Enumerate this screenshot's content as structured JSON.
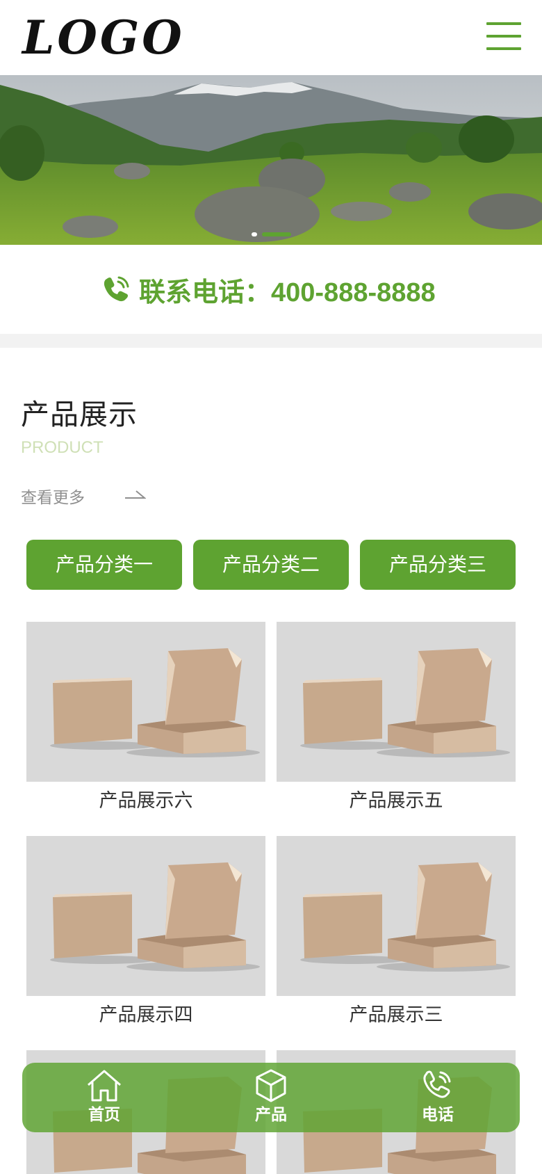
{
  "header": {
    "logo_text": "LOGO",
    "menu_icon": "hamburger-menu-icon"
  },
  "banner": {
    "alt_scene": "mountain-meadow-photo",
    "slide_count": 2,
    "active_slide": 2
  },
  "contact": {
    "phone_label": "联系电话：400-888-8888",
    "icon": "phone-icon"
  },
  "section": {
    "title": "产品展示",
    "subtitle": "PRODUCT",
    "more_label": "查看更多"
  },
  "categories": [
    {
      "label": "产品分类一"
    },
    {
      "label": "产品分类二"
    },
    {
      "label": "产品分类三"
    }
  ],
  "products": [
    {
      "name": "产品展示六"
    },
    {
      "name": "产品展示五"
    },
    {
      "name": "产品展示四"
    },
    {
      "name": "产品展示三"
    },
    {
      "name": ""
    },
    {
      "name": ""
    }
  ],
  "bottom_nav": [
    {
      "label": "首页",
      "icon": "home-icon"
    },
    {
      "label": "产品",
      "icon": "cube-icon"
    },
    {
      "label": "电话",
      "icon": "phone-icon"
    }
  ],
  "colors": {
    "accent": "#5ea331",
    "subtitle": "#cfe0b6",
    "text": "#333333"
  }
}
